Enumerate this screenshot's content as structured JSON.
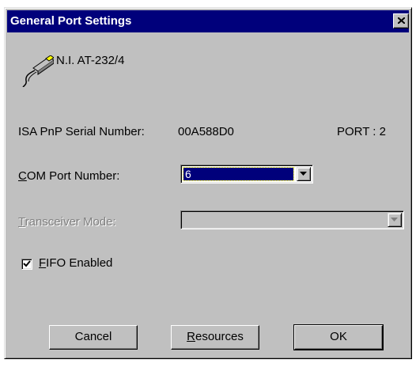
{
  "window": {
    "title": "General Port Settings"
  },
  "device": {
    "name": "N.I. AT-232/4",
    "icon": "serial-cable-icon"
  },
  "serial": {
    "label": "ISA PnP Serial Number:",
    "value": "00A588D0",
    "port": "PORT : 2"
  },
  "com_port": {
    "label_accel": "C",
    "label_rest": "OM Port Number:",
    "value": "6"
  },
  "transceiver": {
    "label_accel": "T",
    "label_rest": "ransceiver Mode:",
    "value": ""
  },
  "fifo": {
    "label_accel": "F",
    "label_rest": "IFO Enabled",
    "checked": true
  },
  "buttons": {
    "cancel": "Cancel",
    "resources_accel": "R",
    "resources_rest": "esources",
    "ok": "OK"
  }
}
